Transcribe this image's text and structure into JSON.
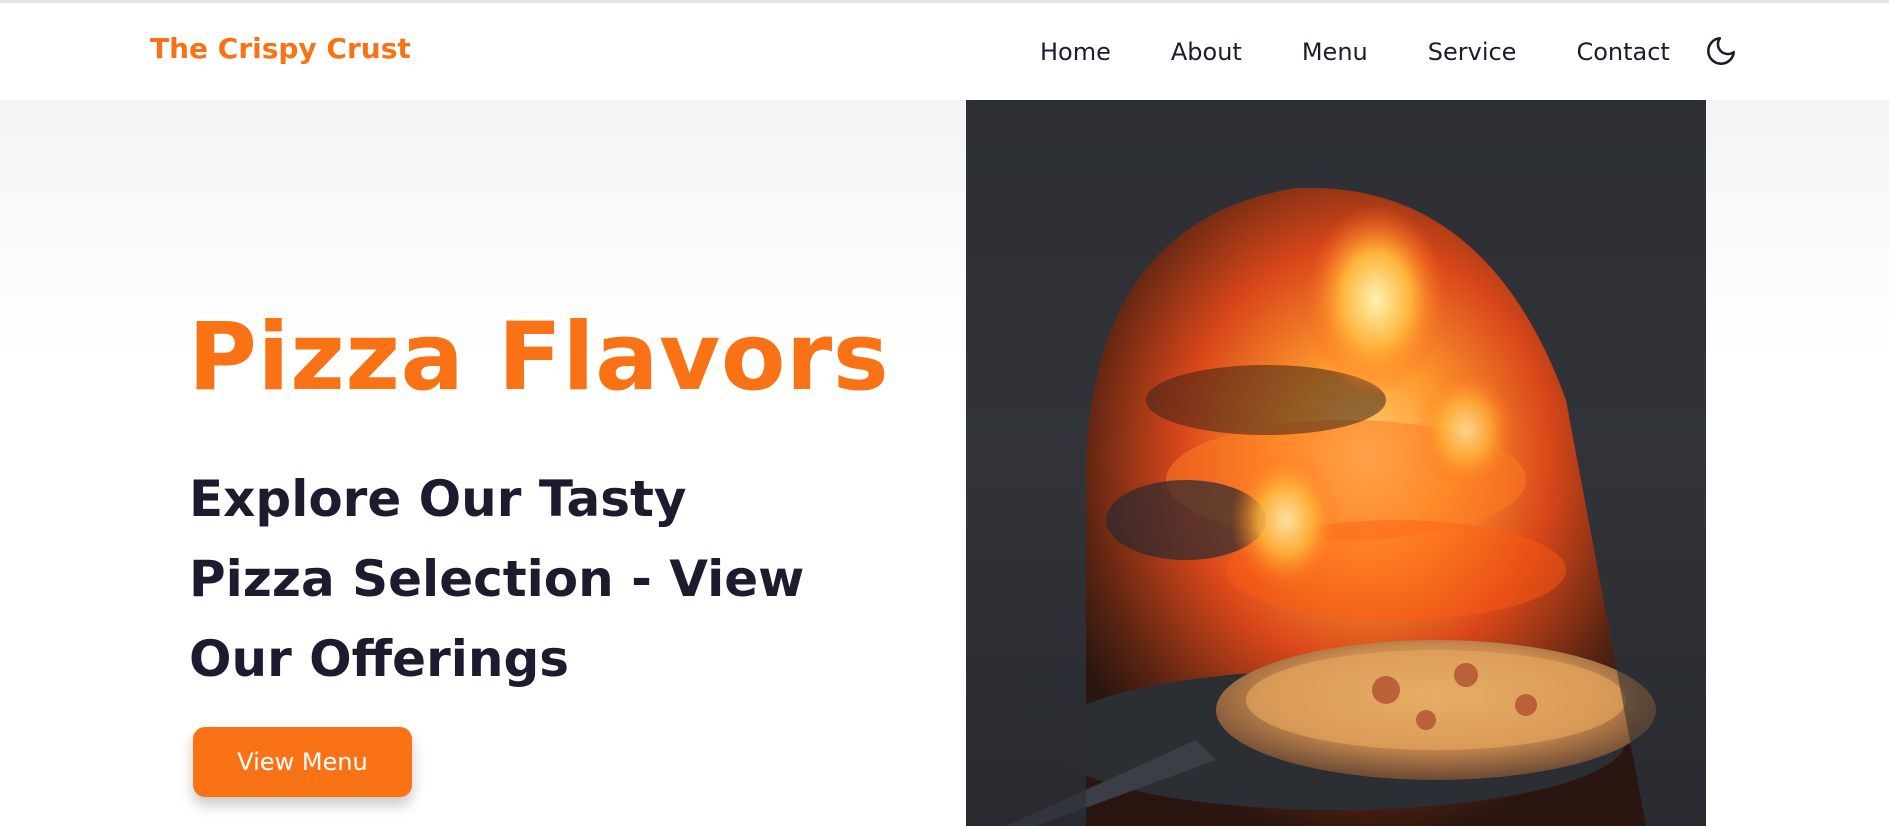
{
  "header": {
    "brand": "The Crispy Crust",
    "nav": [
      "Home",
      "About",
      "Menu",
      "Service",
      "Contact"
    ],
    "theme_toggle_icon": "moon-icon"
  },
  "hero": {
    "title": "Pizza Flavors",
    "subtitle": "Explore Our Tasty Pizza Selection - View Our Offerings",
    "cta_label": "View Menu",
    "image": "pizza-oven-photo"
  },
  "colors": {
    "accent": "#f97316",
    "text_dark": "#1e1b2e",
    "background": "#ffffff"
  }
}
